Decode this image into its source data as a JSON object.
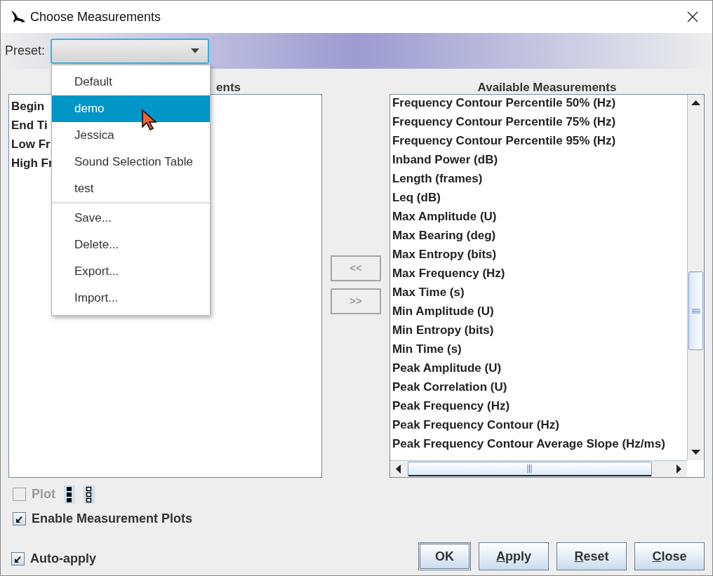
{
  "window": {
    "title": "Choose Measurements"
  },
  "preset": {
    "label": "Preset:",
    "open": true,
    "menu_groups": [
      [
        {
          "label": "Default",
          "selected": false
        },
        {
          "label": "demo",
          "selected": true
        },
        {
          "label": "Jessica",
          "selected": false
        },
        {
          "label": "Sound Selection Table",
          "selected": false
        },
        {
          "label": "test",
          "selected": false
        }
      ],
      [
        {
          "label": "Save...",
          "selected": false
        },
        {
          "label": "Delete...",
          "selected": false
        },
        {
          "label": "Export...",
          "selected": false
        },
        {
          "label": "Import...",
          "selected": false
        }
      ]
    ]
  },
  "selected_panel": {
    "heading": "ents",
    "items": [
      "Begin",
      "End Ti",
      "Low Fr",
      "High Fr"
    ]
  },
  "move_buttons": [
    {
      "label": "<<",
      "disabled": true
    },
    {
      "label": ">>",
      "disabled": true
    }
  ],
  "available_panel": {
    "heading": "Available Measurements",
    "items": [
      "Frequency Contour Percentile 50% (Hz)",
      "Frequency Contour Percentile 75% (Hz)",
      "Frequency Contour Percentile 95% (Hz)",
      "Inband Power (dB)",
      "Length (frames)",
      "Leq (dB)",
      "Max Amplitude (U)",
      "Max Bearing (deg)",
      "Max Entropy (bits)",
      "Max Frequency (Hz)",
      "Max Time (s)",
      "Min Amplitude (U)",
      "Min Entropy (bits)",
      "Min Time (s)",
      "Peak Amplitude (U)",
      "Peak Correlation (U)",
      "Peak Frequency (Hz)",
      "Peak Frequency Contour (Hz)",
      "Peak Frequency Contour Average Slope (Hz/ms)"
    ]
  },
  "plot_checkbox": {
    "label": "Plot",
    "checked": false,
    "disabled": true
  },
  "enable_plots": {
    "label": "Enable Measurement Plots",
    "checked": true,
    "disabled": false
  },
  "auto_apply": {
    "label": "Auto-apply",
    "checked": true,
    "disabled": false
  },
  "buttons": [
    {
      "label": "OK",
      "default": true,
      "underline_first": false
    },
    {
      "label": "Apply",
      "default": false,
      "underline_first": true
    },
    {
      "label": "Reset",
      "default": false,
      "underline_first": true
    },
    {
      "label": "Close",
      "default": false,
      "underline_first": true
    }
  ]
}
